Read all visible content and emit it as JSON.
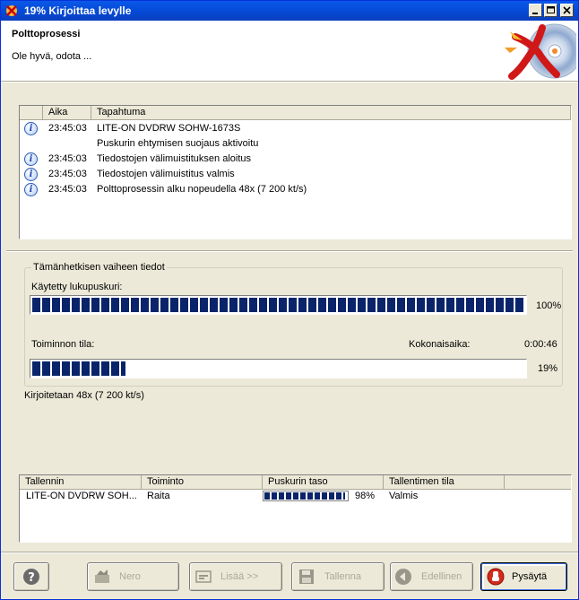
{
  "window": {
    "title": "19% Kirjoittaa levylle",
    "controls": [
      "minimize-icon",
      "maximize-icon",
      "close-icon"
    ]
  },
  "header": {
    "title": "Polttoprosessi",
    "subtitle": "Ole hyvä, odota ..."
  },
  "log": {
    "columns": [
      "Aika",
      "Tapahtuma"
    ],
    "rows": [
      {
        "icon": "info-icon",
        "time": "23:45:03",
        "event": "LITE-ON DVDRW SOHW-1673S"
      },
      {
        "icon": "",
        "time": "",
        "event": "Puskurin ehtymisen suojaus aktivoitu"
      },
      {
        "icon": "info-icon",
        "time": "23:45:03",
        "event": "Tiedostojen välimuistituksen aloitus"
      },
      {
        "icon": "info-icon",
        "time": "23:45:03",
        "event": "Tiedostojen välimuistitus valmis"
      },
      {
        "icon": "info-icon",
        "time": "23:45:03",
        "event": "Polttoprosessin alku nopeudella 48x (7 200 kt/s)"
      }
    ]
  },
  "phase": {
    "legend": "Tämänhetkisen vaiheen tiedot",
    "buffer_label": "Käytetty lukupuskuri:",
    "buffer_percent_text": "100%",
    "buffer_fraction": 1.0,
    "status_label": "Toiminnon tila:",
    "total_time_label": "Kokonaisaika:",
    "total_time": "0:00:46",
    "progress_percent_text": "19%",
    "progress_fraction": 0.19
  },
  "speed_text": "Kirjoitetaan 48x (7 200 kt/s)",
  "recorders": {
    "columns": [
      "Tallennin",
      "Toiminto",
      "Puskurin taso",
      "Tallentimen tila"
    ],
    "rows": [
      {
        "recorder": "LITE-ON DVDRW SOH...",
        "action": "Raita",
        "buffer_text": "98%",
        "buffer_fraction": 0.98,
        "status": "Valmis"
      }
    ]
  },
  "buttons": {
    "help": {
      "icon": "help-icon"
    },
    "nero": {
      "label": "Nero",
      "icon": "nero-icon"
    },
    "more": {
      "label": "Lisää >>",
      "icon": "more-icon"
    },
    "save": {
      "label": "Tallenna",
      "icon": "floppy-disk-icon"
    },
    "back": {
      "label": "Edellinen",
      "icon": "back-arrow-icon"
    },
    "stop": {
      "label": "Pysäytä",
      "icon": "stop-icon"
    }
  },
  "colors": {
    "titlebar": "#0548d4",
    "progress_fill": "#0a246a",
    "window_bg": "#ece9d8"
  }
}
